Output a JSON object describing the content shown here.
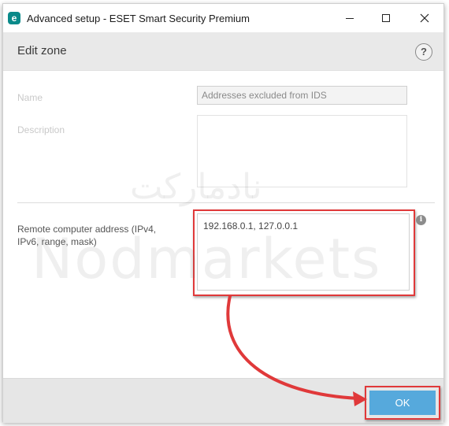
{
  "window": {
    "title": "Advanced setup - ESET Smart Security Premium",
    "app_icon": "e"
  },
  "header": {
    "title": "Edit zone",
    "help_symbol": "?"
  },
  "form": {
    "name_label": "Name",
    "name_value": "Addresses excluded from IDS",
    "description_label": "Description",
    "description_value": "",
    "remote_label": "Remote computer address (IPv4, IPv6, range, mask)",
    "remote_value": "192.168.0.1, 127.0.0.1",
    "info_symbol": "i"
  },
  "footer": {
    "ok_label": "OK"
  },
  "watermark": {
    "latin": "Nodmarkets",
    "arabic": "نادمارکت"
  },
  "colors": {
    "highlight": "#e0393a",
    "ok_button": "#56a9dc",
    "header_bg": "#e9e9e9",
    "footer_bg": "#e6e6e6"
  }
}
